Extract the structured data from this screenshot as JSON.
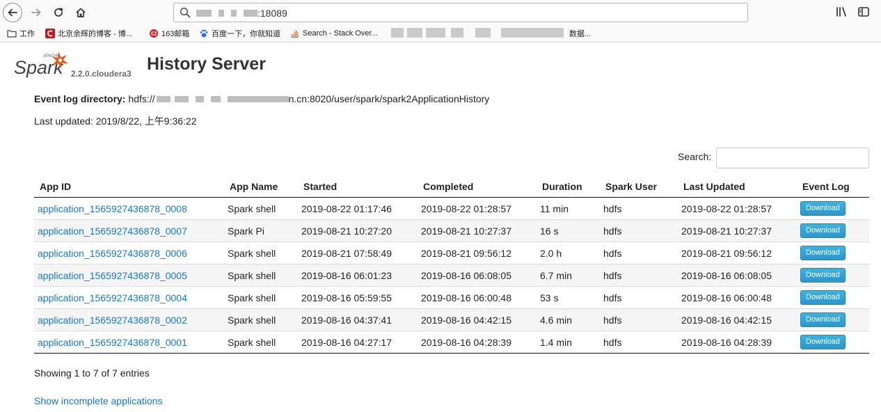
{
  "browser": {
    "url": {
      "port_suffix": ":18089"
    },
    "bookmarks": [
      {
        "label": "工作",
        "icon": "folder-icon"
      },
      {
        "label": "北京余辉的博客 - 博...",
        "icon": "csdn-icon"
      },
      {
        "label": "163邮箱",
        "icon": "mail-icon"
      },
      {
        "label": "百度一下，你就知道",
        "icon": "baidu-icon"
      },
      {
        "label": "Search - Stack Over...",
        "icon": "stackoverflow-icon"
      }
    ],
    "bookmark_tail": "数据..."
  },
  "app": {
    "logo_text": "Spark",
    "logo_small_text": "APACHE",
    "version": "2.2.0.cloudera3",
    "title": "History Server"
  },
  "info": {
    "event_log_label": "Event log directory:",
    "event_log_prefix": "hdfs://",
    "event_log_suffix": "n.cn:8020/user/spark/spark2ApplicationHistory",
    "last_updated": "Last updated: 2019/8/22, 上午9:36:22"
  },
  "search": {
    "label": "Search:",
    "value": ""
  },
  "table": {
    "columns": [
      "App ID",
      "App Name",
      "Started",
      "Completed",
      "Duration",
      "Spark User",
      "Last Updated",
      "Event Log"
    ],
    "rows": [
      {
        "app_id": "application_1565927436878_0008",
        "name": "Spark shell",
        "started": "2019-08-22 01:17:46",
        "completed": "2019-08-22 01:28:57",
        "duration": "11 min",
        "user": "hdfs",
        "last_updated": "2019-08-22 01:28:57",
        "event_log": "Download"
      },
      {
        "app_id": "application_1565927436878_0007",
        "name": "Spark Pi",
        "started": "2019-08-21 10:27:20",
        "completed": "2019-08-21 10:27:37",
        "duration": "16 s",
        "user": "hdfs",
        "last_updated": "2019-08-21 10:27:37",
        "event_log": "Download"
      },
      {
        "app_id": "application_1565927436878_0006",
        "name": "Spark shell",
        "started": "2019-08-21 07:58:49",
        "completed": "2019-08-21 09:56:12",
        "duration": "2.0 h",
        "user": "hdfs",
        "last_updated": "2019-08-21 09:56:12",
        "event_log": "Download"
      },
      {
        "app_id": "application_1565927436878_0005",
        "name": "Spark shell",
        "started": "2019-08-16 06:01:23",
        "completed": "2019-08-16 06:08:05",
        "duration": "6.7 min",
        "user": "hdfs",
        "last_updated": "2019-08-16 06:08:05",
        "event_log": "Download"
      },
      {
        "app_id": "application_1565927436878_0004",
        "name": "Spark shell",
        "started": "2019-08-16 05:59:55",
        "completed": "2019-08-16 06:00:48",
        "duration": "53 s",
        "user": "hdfs",
        "last_updated": "2019-08-16 06:00:48",
        "event_log": "Download"
      },
      {
        "app_id": "application_1565927436878_0002",
        "name": "Spark shell",
        "started": "2019-08-16 04:37:41",
        "completed": "2019-08-16 04:42:15",
        "duration": "4.6 min",
        "user": "hdfs",
        "last_updated": "2019-08-16 04:42:15",
        "event_log": "Download"
      },
      {
        "app_id": "application_1565927436878_0001",
        "name": "Spark shell",
        "started": "2019-08-16 04:27:17",
        "completed": "2019-08-16 04:28:39",
        "duration": "1.4 min",
        "user": "hdfs",
        "last_updated": "2019-08-16 04:28:39",
        "event_log": "Download"
      }
    ]
  },
  "footer": {
    "showing": "Showing 1 to 7 of 7 entries",
    "incomplete_link": "Show incomplete applications"
  },
  "colors": {
    "link": "#1b77c5",
    "button": "#3fb2e0",
    "logo_orange": "#e25a1c"
  }
}
